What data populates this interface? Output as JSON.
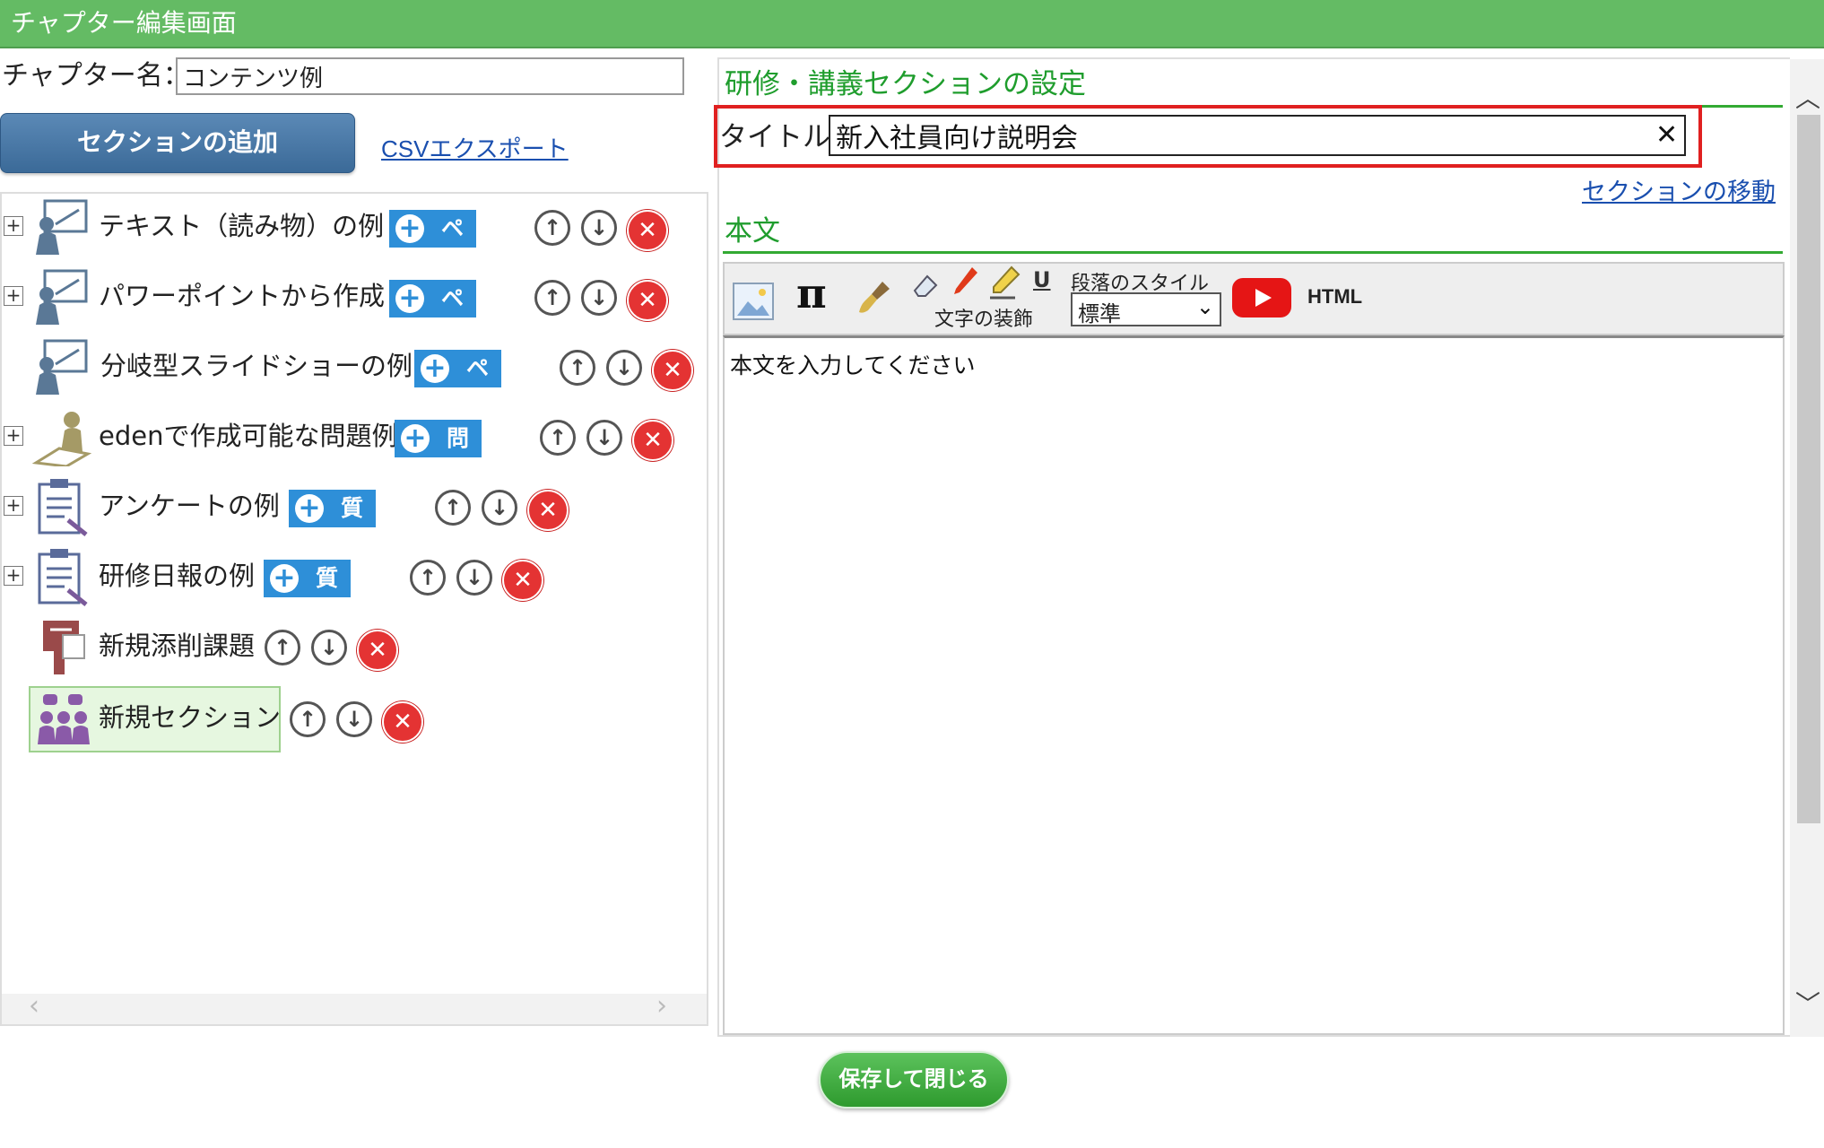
{
  "window": {
    "title": "チャプター編集画面"
  },
  "chapter": {
    "label": "チャプター名：",
    "value": "コンテンツ例"
  },
  "left": {
    "add_section": "セクションの追加",
    "csv_export": "CSVエクスポート",
    "sections": [
      {
        "label": "テキスト（読み物）の例",
        "type": "ページ",
        "icon": "presenter-icon"
      },
      {
        "label": "パワーポイントから作成",
        "type": "ページ",
        "icon": "presenter-icon"
      },
      {
        "label": "分岐型スライドショーの例",
        "type": "ページ",
        "icon": "presenter-icon"
      },
      {
        "label": "edenで作成可能な問題例",
        "type": "問題",
        "icon": "test-taker-icon"
      },
      {
        "label": "アンケートの例",
        "type": "質問",
        "icon": "clipboard-icon"
      },
      {
        "label": "研修日報の例",
        "type": "質問",
        "icon": "clipboard-icon"
      },
      {
        "label": "新規添削課題",
        "type": "",
        "icon": "postbox-icon"
      },
      {
        "label": "新規セクション",
        "type": "",
        "icon": "group-discussion-icon"
      }
    ]
  },
  "right": {
    "heading": "研修・講義セクションの設定",
    "title_label": "タイトル:",
    "title_value": "新入社員向け説明会",
    "move_section": "セクションの移動",
    "body_heading": "本文",
    "toolbar": {
      "decoration_label": "文字の装飾",
      "paragraph_style_label": "段落のスタイル",
      "paragraph_style_value": "標準",
      "html_label": "HTML",
      "underline_label": "U",
      "pi_label": "π"
    },
    "body_placeholder": "本文を入力してください"
  },
  "footer": {
    "save_close": "保存して閉じる"
  }
}
